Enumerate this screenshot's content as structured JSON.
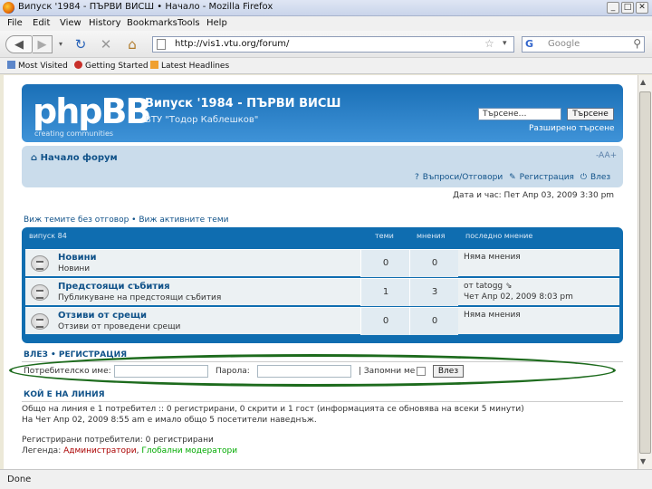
{
  "browser": {
    "window_title": "Випуск '1984 - ПЪРВИ ВИСШ • Начало - Mozilla Firefox",
    "menu": [
      "File",
      "Edit",
      "View",
      "History",
      "Bookmarks",
      "Tools",
      "Help"
    ],
    "url": "http://vis1.vtu.org/forum/",
    "search_placeholder": "Google",
    "bookmarks": [
      "Most Visited",
      "Getting Started",
      "Latest Headlines"
    ],
    "status": "Done"
  },
  "header": {
    "logo": "phpBB",
    "logo_sub": "creating communities",
    "site_title": "Випуск '1984 - ПЪРВИ ВИСШ",
    "site_desc": "ВТУ \"Тодор Каблешков\"",
    "search_placeholder": "Търсене…",
    "search_button": "Търсене",
    "advanced_search": "Разширено търсене"
  },
  "nav": {
    "forum_home": "Начало форум",
    "font_size": "-AA+",
    "faq": "Въпроси/Отговори",
    "register": "Регистрация",
    "login": "Влез"
  },
  "datetime": "Дата и час: Пет Апр 03, 2009 3:30 pm",
  "view_links": "Виж темите без отговор • Виж активните теми",
  "forums": {
    "headers": [
      "Випуск 84",
      "Теми",
      "Мнения",
      "Последно мнение"
    ],
    "rows": [
      {
        "name": "Новини",
        "desc": "Новини",
        "topics": "0",
        "posts": "0",
        "last": "Няма мнения",
        "last2": ""
      },
      {
        "name": "Предстоящи събития",
        "desc": "Публикуване на предстоящи събития",
        "topics": "1",
        "posts": "3",
        "last": "от tatogg ⇘",
        "last2": "Чет Апр 02, 2009 8:03 pm"
      },
      {
        "name": "Отзиви от срещи",
        "desc": "Отзиви от проведени срещи",
        "topics": "0",
        "posts": "0",
        "last": "Няма мнения",
        "last2": ""
      }
    ]
  },
  "login": {
    "title": "ВЛЕЗ • РЕГИСТРАЦИЯ",
    "username_label": "Потребителско име:",
    "password_label": "Парола:",
    "remember_label": "| Запомни ме",
    "button": "Влез"
  },
  "online": {
    "title": "КОЙ Е НА ЛИНИЯ",
    "line1": "Общо на линия е 1 потребител :: 0 регистрирани, 0 скрити и 1 гост (информацията се обновява на всеки 5 минути)",
    "line2": "На Чет Апр 02, 2009 8:55 am е имало общо 5 посетители наведнъж.",
    "line3": "Регистрирани потребители: 0 регистрирани",
    "legend_label": "Легенда:",
    "admins": "Администратори",
    "global_mods": "Глобални модератори"
  }
}
